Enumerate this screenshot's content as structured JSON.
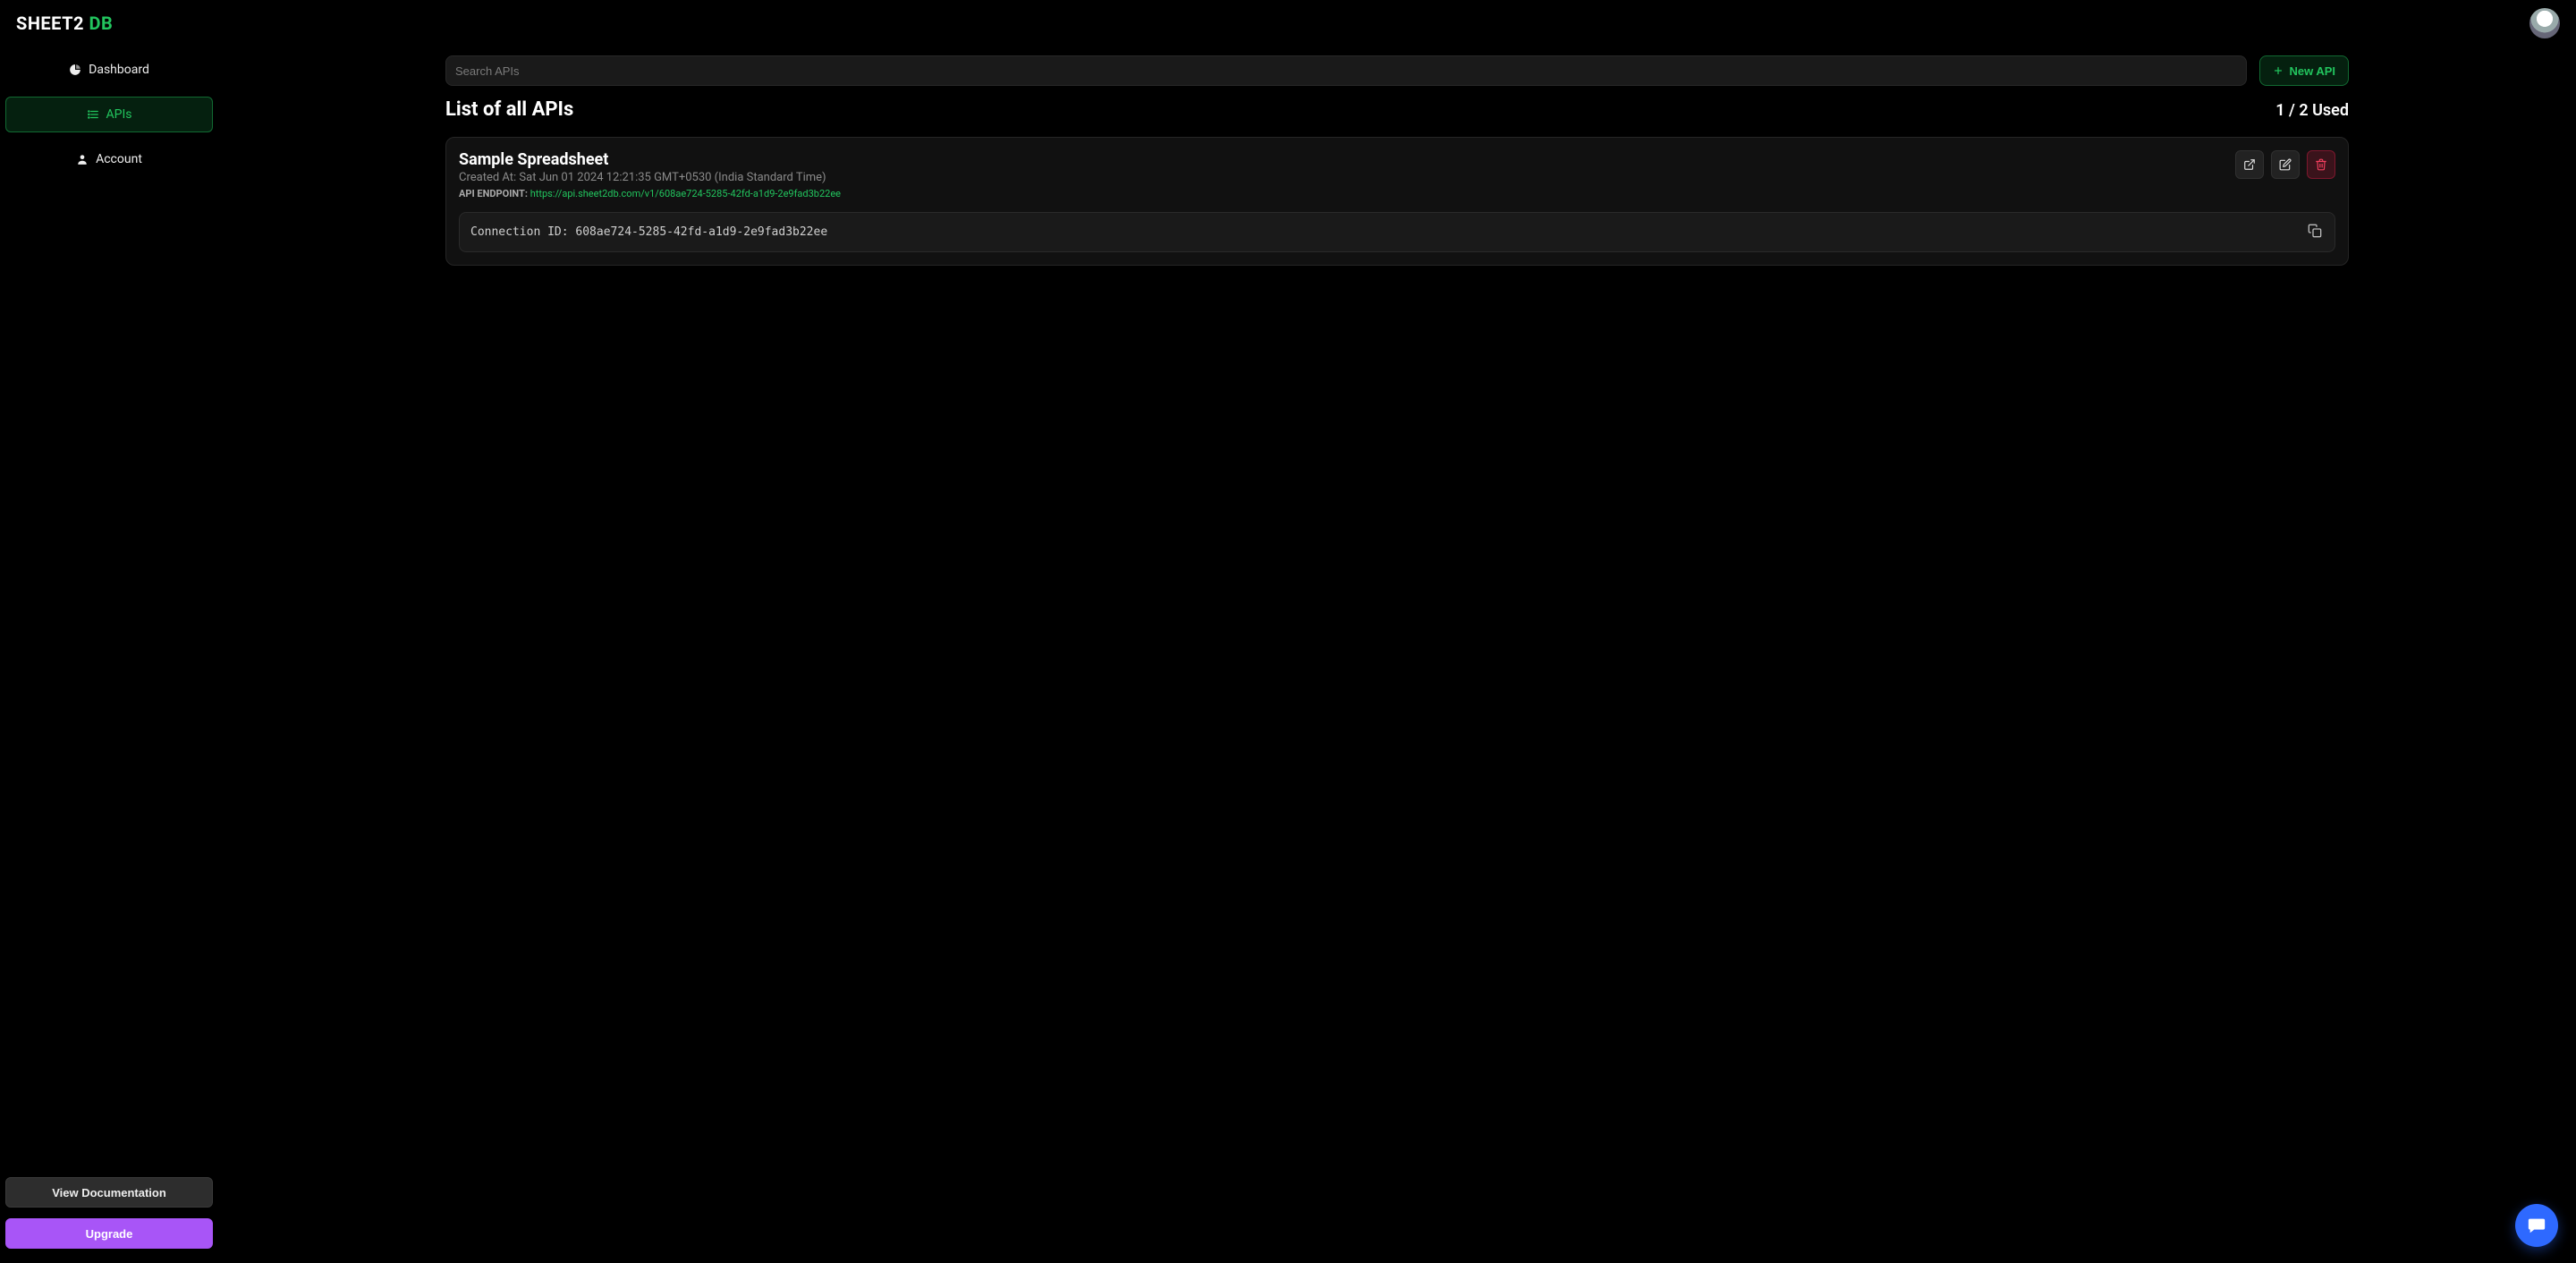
{
  "brand": {
    "part1": "SHEET2",
    "part2": "DB"
  },
  "sidebar": {
    "items": [
      {
        "label": "Dashboard"
      },
      {
        "label": "APIs"
      },
      {
        "label": "Account"
      }
    ],
    "docs_label": "View Documentation",
    "upgrade_label": "Upgrade"
  },
  "search": {
    "placeholder": "Search APIs"
  },
  "new_api_label": "New API",
  "list": {
    "title": "List of all APIs",
    "usage": "1 / 2 Used"
  },
  "api_card": {
    "title": "Sample Spreadsheet",
    "created_label": "Created At:",
    "created_value": "Sat Jun 01 2024 12:21:35 GMT+0530 (India Standard Time)",
    "endpoint_label": "API ENDPOINT:",
    "endpoint_url": "https://api.sheet2db.com/v1/608ae724-5285-42fd-a1d9-2e9fad3b22ee",
    "connection_label": "Connection ID:",
    "connection_id": "608ae724-5285-42fd-a1d9-2e9fad3b22ee"
  }
}
